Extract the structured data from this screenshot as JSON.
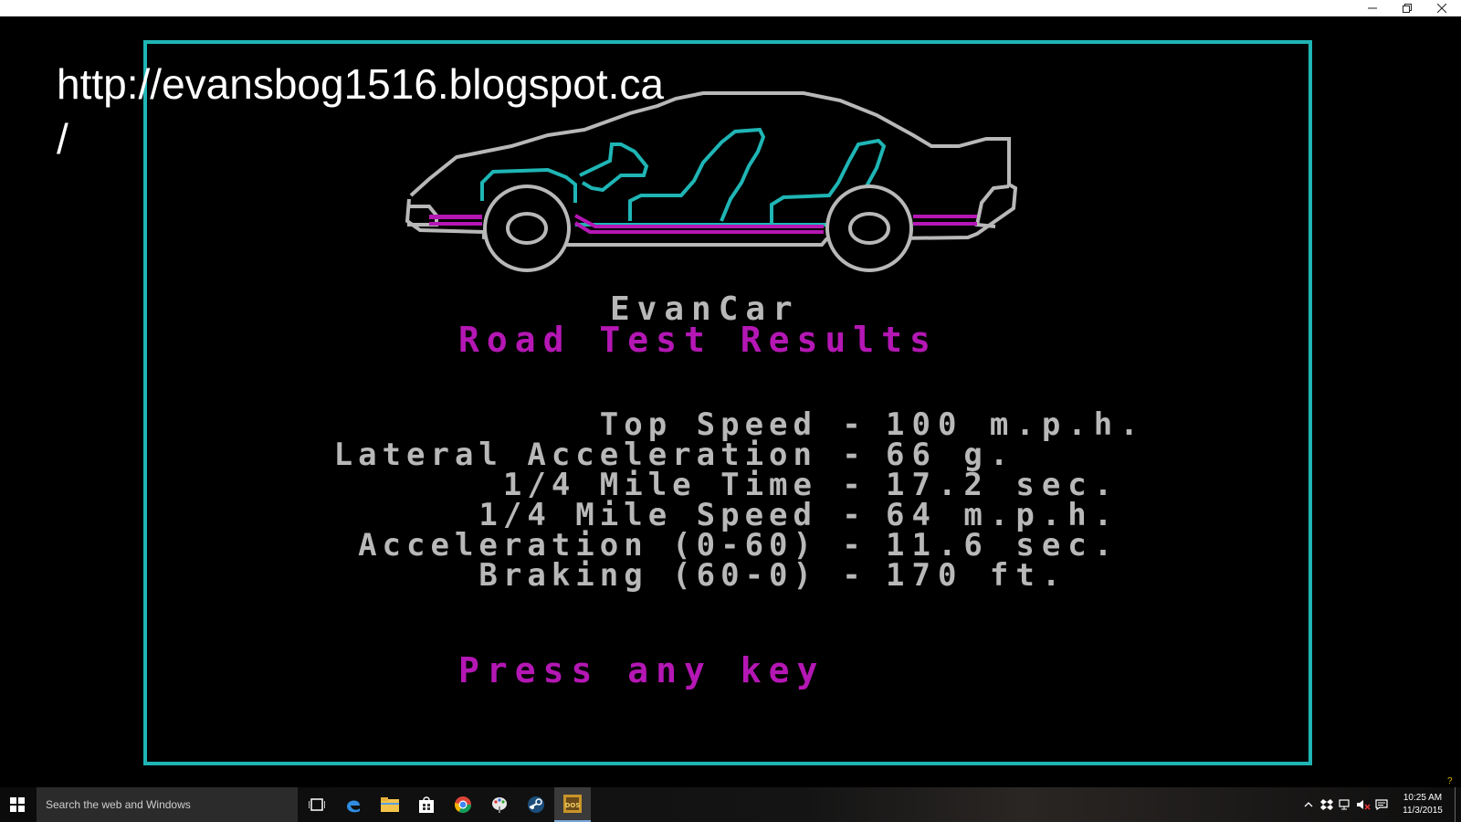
{
  "window": {
    "minimize_glyph": "–",
    "restore_glyph": "❐",
    "close_glyph": "✕"
  },
  "overlay": {
    "url": "http://evansbog1516.blogspot.ca\n/"
  },
  "game": {
    "car_name": "EvanCar",
    "results_title": "Road Test Results",
    "stats": [
      {
        "label": "Top Speed",
        "value": "100 m.p.h."
      },
      {
        "label": "Lateral Acceleration",
        "value": "66 g."
      },
      {
        "label": "1/4 Mile Time",
        "value": "17.2 sec."
      },
      {
        "label": "1/4 Mile Speed",
        "value": "64 m.p.h."
      },
      {
        "label": "Acceleration (0-60)",
        "value": "11.6 sec."
      },
      {
        "label": "Braking (60-0)",
        "value": "170 ft."
      }
    ],
    "separator": "-",
    "prompt": "Press any key",
    "colors": {
      "frame": "#1fb5b5",
      "outline": "#b8b8b8",
      "interior": "#1fb5b5",
      "chassis": "#b417b4",
      "title": "#b417b4"
    }
  },
  "taskbar": {
    "search_placeholder": "Search the web and Windows",
    "pinned": [
      "task-view-icon",
      "edge-icon",
      "file-explorer-icon",
      "store-icon",
      "chrome-icon",
      "paint-app-icon",
      "steam-icon",
      "dosbox-icon"
    ],
    "active_app": "dosbox-icon",
    "tray_icons": [
      "chevron-up-icon",
      "dropbox-icon",
      "network-icon",
      "volume-muted-icon",
      "notification-icon"
    ],
    "clock_time": "10:25 AM",
    "clock_date": "11/3/2015"
  },
  "corner_mark": "?"
}
